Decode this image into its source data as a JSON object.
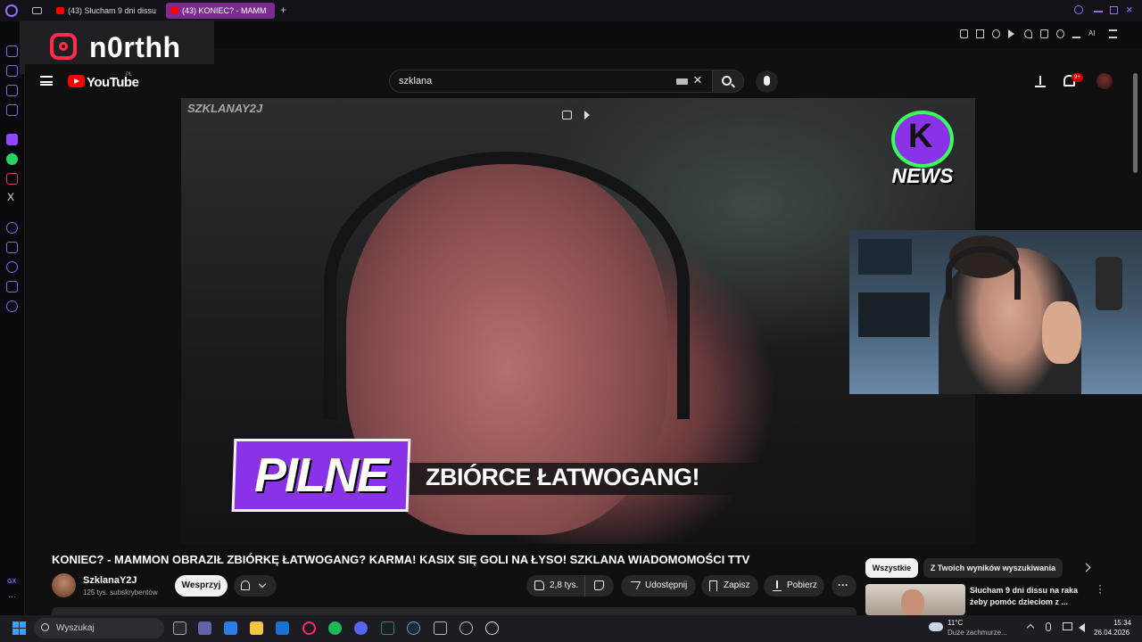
{
  "browser": {
    "tabs": [
      {
        "label": "(43) Słucham 9 dni dissu n"
      },
      {
        "label": "(43) KONIEC? - MAMM"
      }
    ],
    "new_tab": "+"
  },
  "overlay": {
    "instagram_handle": "n0rthh"
  },
  "youtube": {
    "logo_text": "YouTube",
    "region": "PL",
    "search_value": "szklana",
    "notification_count": "9+"
  },
  "video": {
    "watermark": "SZKLANAY2J",
    "logo_text": "NEWS",
    "badge": "PILNE",
    "ticker": "ZBIÓRCE ŁATWOGANG!"
  },
  "meta": {
    "title": "KONIEC? - MAMMON OBRAZIŁ ZBIÓRKĘ ŁATWOGANG? KARMA! KASIX SIĘ GOLI NA ŁYSO! SZKLANA WIADOMOMOŚCI TTV",
    "channel": "SzklanaY2J",
    "subscribers": "125 tys. subskrybentów",
    "support_label": "Wesprzyj",
    "likes": "2,8 tys.",
    "share_label": "Udostępnij",
    "save_label": "Zapisz",
    "download_label": "Pobierz"
  },
  "related": {
    "chips": [
      "Wszystkie",
      "Z Twoich wyników wyszukiwania"
    ],
    "first_title": "Słucham 9 dni dissu na raka żeby pomóc dzieciom z ..."
  },
  "taskbar": {
    "search_placeholder": "Wyszukaj",
    "temperature": "11°C",
    "weather": "Duże zachmurze...",
    "time": "15:34",
    "date": "26.04.2026"
  },
  "sidebar_bottom": "GX",
  "colors": {
    "accent": "#8a32e8",
    "youtube_red": "#ff0000",
    "opera_tab": "#7a2c8f"
  }
}
